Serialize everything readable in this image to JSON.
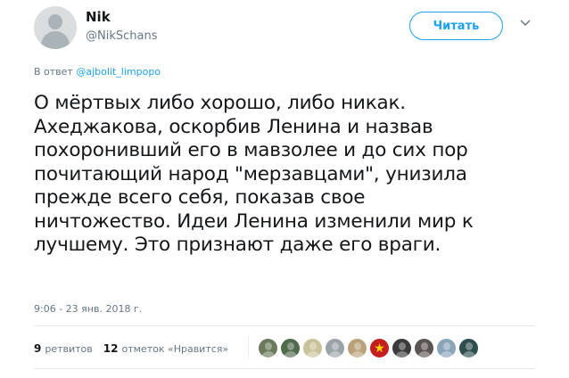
{
  "user": {
    "name": "Nik",
    "handle": "@NikSchans"
  },
  "follow_button": {
    "label": "Читать"
  },
  "reply": {
    "prefix": "В ответ",
    "mention": "@ajbolit_limpopo"
  },
  "tweet": {
    "lines": [
      "О мёртвых либо хорошо, либо никак.",
      "Ахеджакова, оскорбив Ленина и назвав",
      "похоронивший его в мавзолее и до сих пор",
      "почитающий народ \"мерзавцами\", унизила",
      "прежде всего себя, показав свое",
      "ничтожество. Идеи Ленина изменили мир к",
      "лучшему. Это признают даже его враги."
    ],
    "time": "9:06 - 23 янв. 2018 г."
  },
  "stats": {
    "retweets_count": "9",
    "retweets_label": "ретвитов",
    "likes_count": "12",
    "likes_label": "отметок «Нравится»"
  },
  "likers": [
    {
      "icon": "avatar-icon",
      "color": "#6b7a5a"
    },
    {
      "icon": "avatar-icon",
      "color": "#4f6b4a"
    },
    {
      "icon": "avatar-icon",
      "color": "#c9c29a"
    },
    {
      "icon": "avatar-icon",
      "color": "#9aa3a8"
    },
    {
      "icon": "avatar-icon",
      "color": "#b9a27a"
    },
    {
      "icon": "star-icon",
      "color": "#c41e1e"
    },
    {
      "icon": "avatar-icon",
      "color": "#3b3b3b"
    },
    {
      "icon": "avatar-icon",
      "color": "#5a5552"
    },
    {
      "icon": "avatar-icon",
      "color": "#8aa4b8"
    },
    {
      "icon": "avatar-icon",
      "color": "#2f4f4f"
    }
  ],
  "colors": {
    "accent": "#1da1f2",
    "secondary_text": "#657786",
    "primary_text": "#14171a"
  }
}
